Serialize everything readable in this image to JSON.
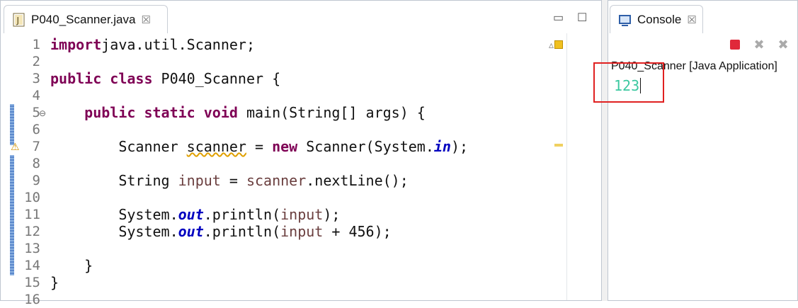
{
  "editor": {
    "tab_title": "P040_Scanner.java",
    "close_glyph": "☒",
    "minimize_glyph": "▭",
    "maximize_glyph": "☐",
    "line_numbers": [
      "1",
      "2",
      "3",
      "4",
      "5",
      "6",
      "7",
      "8",
      "9",
      "10",
      "11",
      "12",
      "13",
      "14",
      "15",
      "16"
    ],
    "lines": [
      {
        "n": "1",
        "parts": [
          [
            "kw",
            "import"
          ],
          [
            "",
            "java.util.Scanner;"
          ]
        ]
      },
      {
        "n": "2",
        "parts": []
      },
      {
        "n": "3",
        "parts": [
          [
            "kw",
            "public class"
          ],
          [
            "",
            " P040_Scanner {"
          ]
        ]
      },
      {
        "n": "4",
        "parts": []
      },
      {
        "n": "5",
        "parts": [
          [
            "",
            "    "
          ],
          [
            "kw",
            "public static void"
          ],
          [
            "",
            " main(String[] args) {"
          ]
        ]
      },
      {
        "n": "6",
        "parts": []
      },
      {
        "n": "7",
        "parts": [
          [
            "",
            "        Scanner "
          ],
          [
            "warn",
            "scanner"
          ],
          [
            "",
            " = "
          ],
          [
            "kw",
            "new"
          ],
          [
            "",
            " Scanner(System."
          ],
          [
            "fld",
            "in"
          ],
          [
            "",
            ");"
          ]
        ]
      },
      {
        "n": "8",
        "parts": []
      },
      {
        "n": "9",
        "parts": [
          [
            "",
            "        String "
          ],
          [
            "var",
            "input"
          ],
          [
            "",
            " = "
          ],
          [
            "var",
            "scanner"
          ],
          [
            "",
            ".nextLine();"
          ]
        ]
      },
      {
        "n": "10",
        "parts": []
      },
      {
        "n": "11",
        "parts": [
          [
            "",
            "        System."
          ],
          [
            "fld",
            "out"
          ],
          [
            "",
            ".println("
          ],
          [
            "var",
            "input"
          ],
          [
            "",
            ");"
          ]
        ]
      },
      {
        "n": "12",
        "parts": [
          [
            "",
            "        System."
          ],
          [
            "fld",
            "out"
          ],
          [
            "",
            ".println("
          ],
          [
            "var",
            "input"
          ],
          [
            "",
            " + 456);"
          ]
        ]
      },
      {
        "n": "13",
        "parts": []
      },
      {
        "n": "14",
        "parts": [
          [
            "",
            "    }"
          ]
        ]
      },
      {
        "n": "15",
        "parts": [
          [
            "",
            "}"
          ]
        ]
      },
      {
        "n": "16",
        "parts": []
      }
    ]
  },
  "console": {
    "tab_title": "Console",
    "close_glyph": "☒",
    "header": "P040_Scanner [Java Application]",
    "output": "123"
  },
  "colors": {
    "keyword": "#7f0055",
    "field": "#0000c0",
    "output_green": "#3cc8a0",
    "highlight_red": "#e02020"
  }
}
